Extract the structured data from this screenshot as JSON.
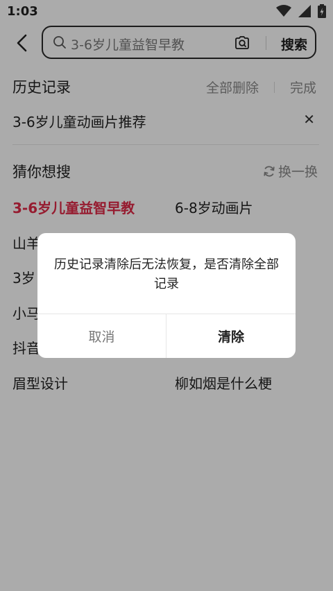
{
  "status_bar": {
    "time": "1:03"
  },
  "search": {
    "query": "3-6岁儿童益智早教",
    "submit_label": "搜索"
  },
  "history": {
    "title": "历史记录",
    "delete_all": "全部删除",
    "done": "完成",
    "items": [
      "3-6岁儿童动画片推荐"
    ]
  },
  "guess": {
    "title": "猜你想搜",
    "refresh_label": "换一换",
    "items": [
      "3-6岁儿童益智早教",
      "6-8岁动画片",
      "山羊",
      "3岁",
      "小马",
      "抖音",
      "眉型设计",
      "柳如烟是什么梗"
    ]
  },
  "dialog": {
    "message": "历史记录清除后无法恢复，是否清除全部记录",
    "cancel": "取消",
    "confirm": "清除"
  },
  "colors": {
    "accent": "#e02a48",
    "overlay": "rgba(0,0,0,0.33)"
  }
}
